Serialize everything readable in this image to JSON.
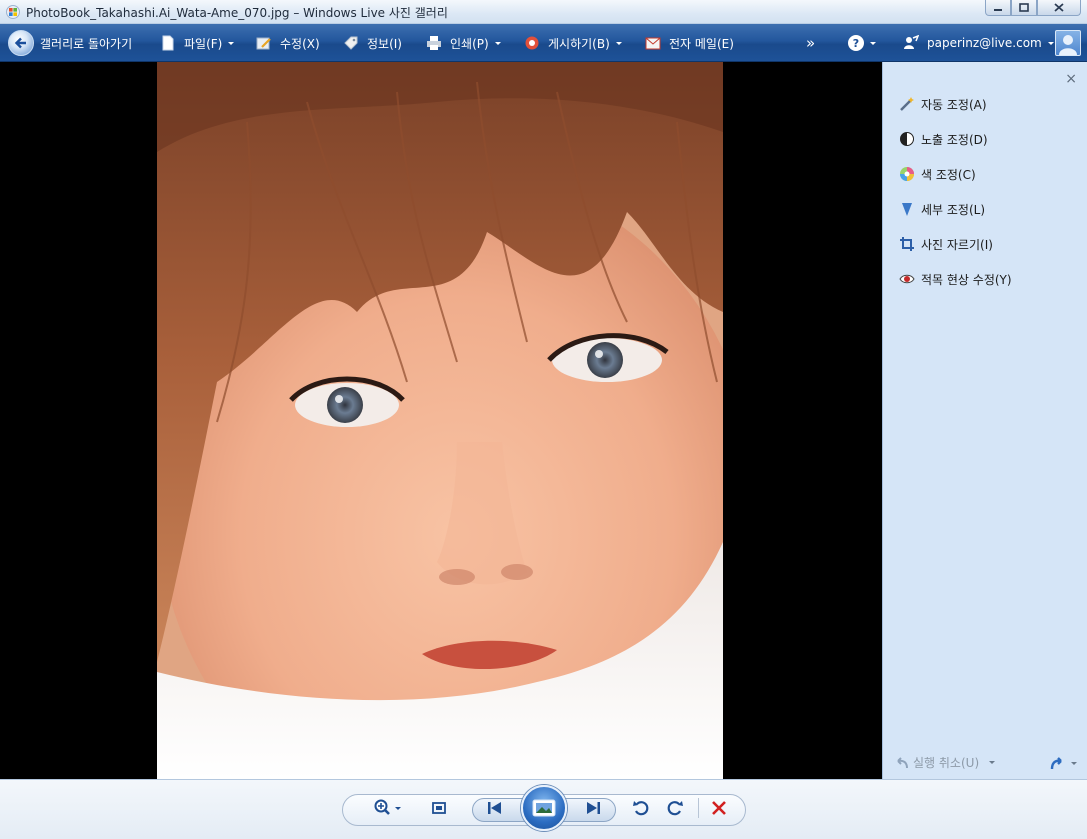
{
  "window": {
    "title": "PhotoBook_Takahashi.Ai_Wata-Ame_070.jpg  –  Windows  Live 사진 갤러리",
    "icon": "windows-logo-icon",
    "controls": [
      "minimize",
      "maximize",
      "close"
    ]
  },
  "toolbar": {
    "back_label": "갤러리로 돌아가기",
    "file_label": "파일(F)",
    "edit_label": "수정(X)",
    "info_label": "정보(I)",
    "print_label": "인쇄(P)",
    "publish_label": "게시하기(B)",
    "email_label": "전자 메일(E)",
    "overflow_label": "»",
    "help_label": "?",
    "account_label": "paperinz@live.com"
  },
  "panel": {
    "close_label": "×",
    "items": [
      {
        "label": "자동 조정(A)",
        "icon": "magic-wand-icon"
      },
      {
        "label": "노출 조정(D)",
        "icon": "exposure-icon"
      },
      {
        "label": "색 조정(C)",
        "icon": "color-wheel-icon"
      },
      {
        "label": "세부 조정(L)",
        "icon": "detail-icon"
      },
      {
        "label": "사진 자르기(I)",
        "icon": "crop-icon"
      },
      {
        "label": "적목 현상 수정(Y)",
        "icon": "red-eye-icon"
      }
    ],
    "undo_label": "실행 취소(U)",
    "redo_icon": "redo-icon"
  },
  "bottombar": {
    "buttons": [
      "zoom",
      "fit",
      "previous",
      "slideshow",
      "next",
      "rotate-left",
      "rotate-right",
      "delete"
    ]
  },
  "colors": {
    "toolbar": "#23579d",
    "panel": "#d5e5f7",
    "stage": "#000000",
    "delete": "#d12020"
  }
}
